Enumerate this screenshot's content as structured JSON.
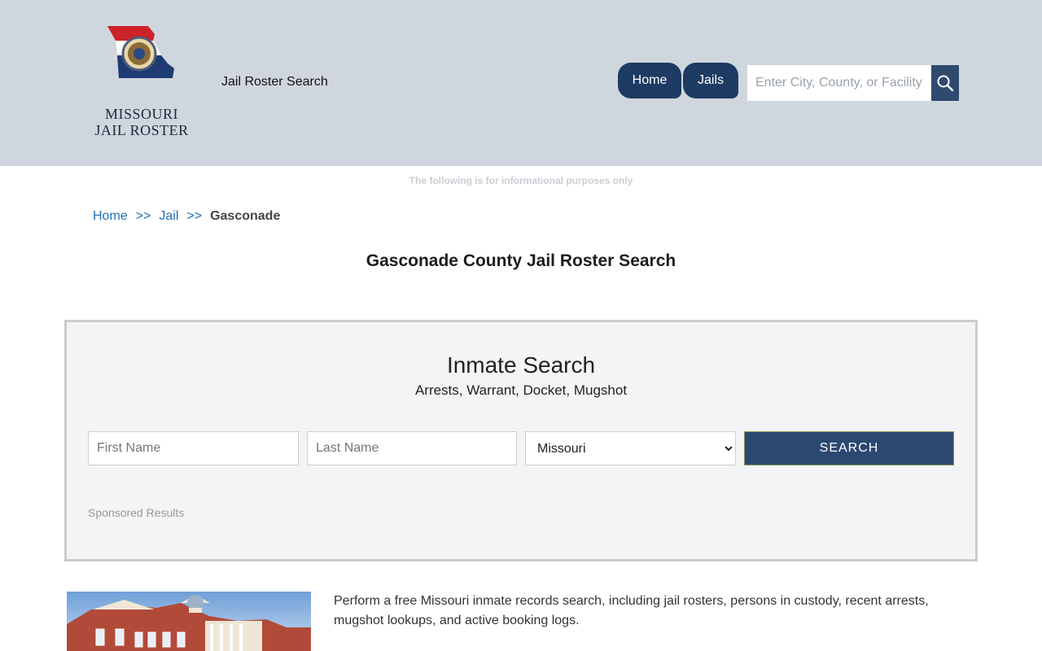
{
  "header": {
    "logo_text_line1": "MISSOURI",
    "logo_text_line2": "JAIL ROSTER",
    "tagline": "Jail Roster Search",
    "nav": [
      {
        "label": "Home"
      },
      {
        "label": "Jails"
      }
    ],
    "search_placeholder": "Enter City, County, or Facility",
    "search_icon": "search-icon"
  },
  "disclaimer": "The following is for informational purposes only",
  "breadcrumb": {
    "items": [
      "Home",
      "Jail"
    ],
    "separator": ">>",
    "current": "Gasconade"
  },
  "page_title": "Gasconade County Jail Roster Search",
  "inmate_search": {
    "title": "Inmate Search",
    "subtitle": "Arrests, Warrant, Docket, Mugshot",
    "first_name_placeholder": "First Name",
    "last_name_placeholder": "Last Name",
    "state_selected": "Missouri",
    "submit_label": "SEARCH",
    "sponsored": "Sponsored Results"
  },
  "intro_text": "Perform a free Missouri inmate records search, including jail rosters, persons in custody, recent arrests, mugshot lookups, and active booking logs.",
  "colors": {
    "header_bg": "#cfd6de",
    "nav_bg": "#1e3b63",
    "button_bg": "#2c4870",
    "link": "#1f6fb8"
  }
}
